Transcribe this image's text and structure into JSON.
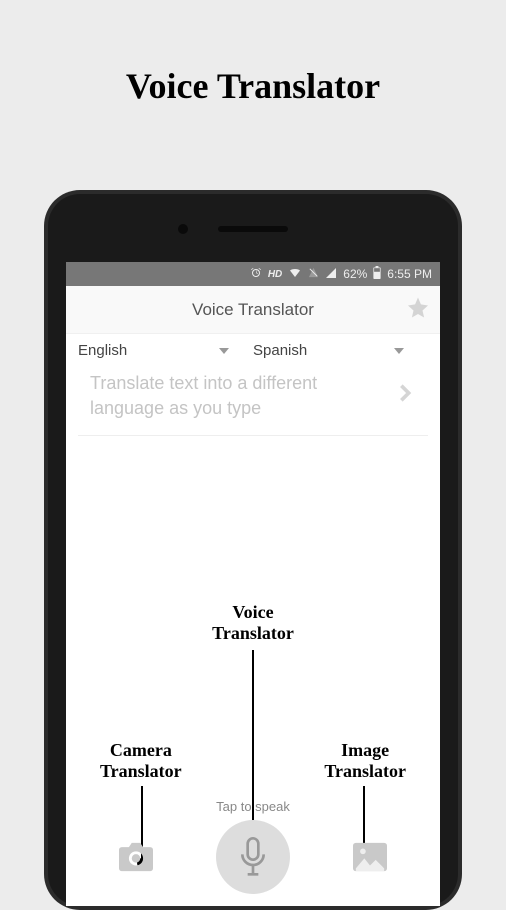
{
  "page": {
    "title": "Voice Translator"
  },
  "status": {
    "hd": "HD",
    "battery_pct": "62%",
    "time": "6:55 PM"
  },
  "header": {
    "title": "Voice Translator"
  },
  "languages": {
    "source": "English",
    "target": "Spanish"
  },
  "input": {
    "placeholder": "Translate text into a different language as you type"
  },
  "speak_prompt": "Tap to speak",
  "annotations": {
    "voice": "Voice\nTranslator",
    "camera": "Camera\nTranslator",
    "image": "Image\nTranslator"
  }
}
